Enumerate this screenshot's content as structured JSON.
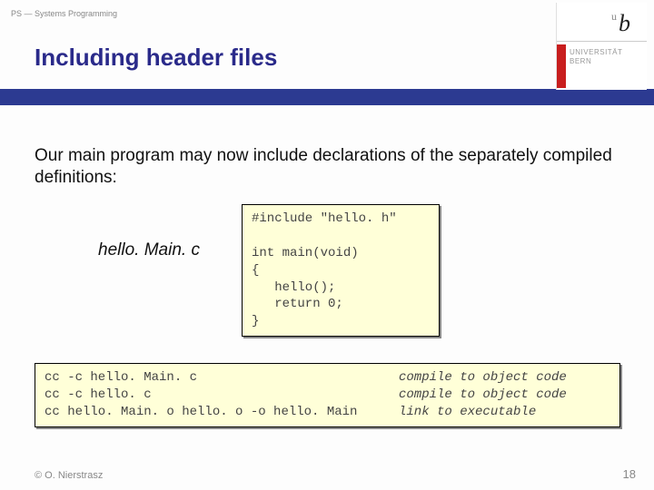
{
  "header": {
    "course": "PS — Systems Programming",
    "title": "Including header files"
  },
  "logo": {
    "letter": "b",
    "sup": "u",
    "line1": "UNIVERSITÄT",
    "line2": "BERN"
  },
  "body": {
    "text": "Our main program may now include declarations of the separately compiled definitions:"
  },
  "file_label": "hello. Main. c",
  "code1": "#include \"hello. h\"\n\nint main(void)\n{\n   hello();\n   return 0;\n}",
  "commands": [
    {
      "cmd": "cc -c hello. Main. c",
      "desc": "compile to object code"
    },
    {
      "cmd": "cc -c hello. c",
      "desc": "compile to object code"
    },
    {
      "cmd": "cc hello. Main. o hello. o -o hello. Main",
      "desc": "link to executable"
    }
  ],
  "footer": {
    "left": "© O. Nierstrasz",
    "right": "18"
  }
}
